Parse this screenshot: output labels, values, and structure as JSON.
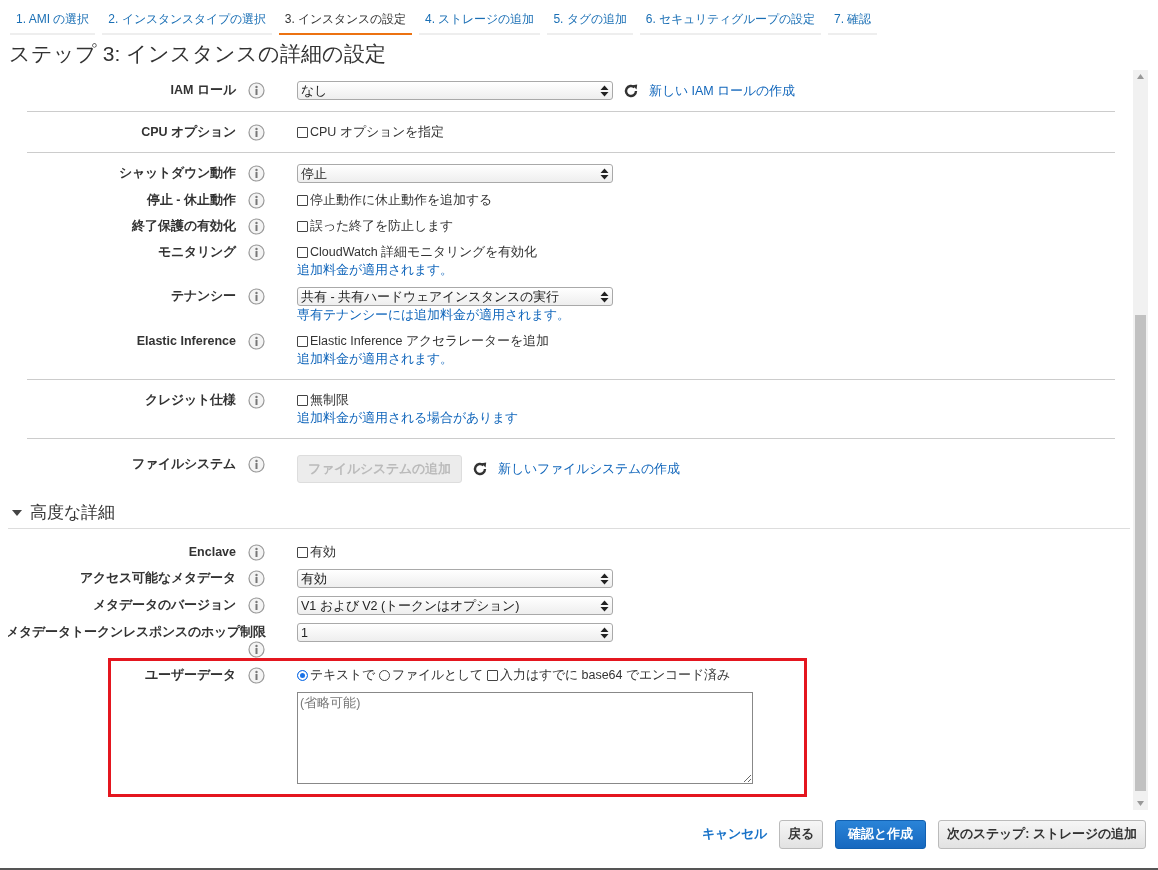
{
  "tabs": [
    {
      "label": "1. AMI の選択",
      "selected": false
    },
    {
      "label": "2. インスタンスタイプの選択",
      "selected": false
    },
    {
      "label": "3. インスタンスの設定",
      "selected": true
    },
    {
      "label": "4. ストレージの追加",
      "selected": false
    },
    {
      "label": "5. タグの追加",
      "selected": false
    },
    {
      "label": "6. セキュリティグループの設定",
      "selected": false
    },
    {
      "label": "7. 確認",
      "selected": false
    }
  ],
  "title": "ステップ 3: インスタンスの詳細の設定",
  "groups": [
    {
      "rows": [
        {
          "label": "IAM ロール",
          "controls": [
            {
              "kind": "select",
              "value": "なし"
            },
            {
              "kind": "refresh_link",
              "text": "新しい IAM ロールの作成"
            }
          ]
        }
      ]
    },
    {
      "rows": [
        {
          "label": "CPU オプション",
          "controls": [
            {
              "kind": "checkbox",
              "label": "CPU オプションを指定",
              "checked": false
            }
          ]
        }
      ]
    },
    {
      "rows": [
        {
          "label": "シャットダウン動作",
          "controls": [
            {
              "kind": "select",
              "value": "停止"
            }
          ]
        },
        {
          "label": "停止 - 休止動作",
          "controls": [
            {
              "kind": "checkbox",
              "label": "停止動作に休止動作を追加する",
              "checked": false
            }
          ]
        },
        {
          "label": "終了保護の有効化",
          "controls": [
            {
              "kind": "checkbox",
              "label": "誤った終了を防止します",
              "checked": false
            }
          ]
        },
        {
          "label": "モニタリング",
          "controls": [
            {
              "kind": "checkbox",
              "label": "CloudWatch 詳細モニタリングを有効化",
              "checked": false
            },
            {
              "kind": "note",
              "text": "追加料金が適用されます。"
            }
          ]
        },
        {
          "label": "テナンシー",
          "controls": [
            {
              "kind": "select",
              "value": "共有 - 共有ハードウェアインスタンスの実行"
            },
            {
              "kind": "note",
              "text": "専有テナンシーには追加料金が適用されます。"
            }
          ]
        },
        {
          "label": "Elastic Inference",
          "controls": [
            {
              "kind": "checkbox",
              "label": "Elastic Inference アクセラレーターを追加",
              "checked": false
            },
            {
              "kind": "note",
              "text": "追加料金が適用されます。"
            }
          ]
        }
      ]
    },
    {
      "rows": [
        {
          "label": "クレジット仕様",
          "controls": [
            {
              "kind": "checkbox",
              "label": "無制限",
              "checked": false
            },
            {
              "kind": "note",
              "text": "追加料金が適用される場合があります"
            }
          ]
        }
      ]
    },
    {
      "rows": [
        {
          "label": "ファイルシステム",
          "controls": [
            {
              "kind": "button",
              "label": "ファイルシステムの追加",
              "disabled": true
            },
            {
              "kind": "refresh_link",
              "text": "新しいファイルシステムの作成"
            }
          ]
        }
      ]
    }
  ],
  "advanced": {
    "title": "高度な詳細",
    "expanded": true,
    "rows": [
      {
        "label": "Enclave",
        "controls": [
          {
            "kind": "checkbox",
            "label": "有効",
            "checked": false
          }
        ]
      },
      {
        "label": "アクセス可能なメタデータ",
        "controls": [
          {
            "kind": "select",
            "value": "有効"
          }
        ]
      },
      {
        "label": "メタデータのバージョン",
        "controls": [
          {
            "kind": "select",
            "value": "V1 および V2 (トークンはオプション)"
          }
        ]
      },
      {
        "label": "メタデータトークンレスポンスのホップ制限",
        "controls": [
          {
            "kind": "select",
            "value": "1"
          }
        ]
      },
      {
        "label": "ユーザーデータ",
        "highlight": true,
        "controls": [
          {
            "kind": "radio",
            "label": "テキストで",
            "selected": true
          },
          {
            "kind": "radio",
            "label": "ファイルとして",
            "selected": false
          },
          {
            "kind": "checkbox",
            "label": "入力はすでに base64 でエンコード済み",
            "checked": false
          },
          {
            "kind": "textarea",
            "placeholder": "(省略可能)"
          }
        ]
      }
    ]
  },
  "footer": {
    "cancel": "キャンセル",
    "buttons": [
      {
        "label": "戻る",
        "kind": "default"
      },
      {
        "label": "確認と作成",
        "kind": "primary"
      },
      {
        "label": "次のステップ: ストレージの追加",
        "kind": "default"
      }
    ]
  }
}
